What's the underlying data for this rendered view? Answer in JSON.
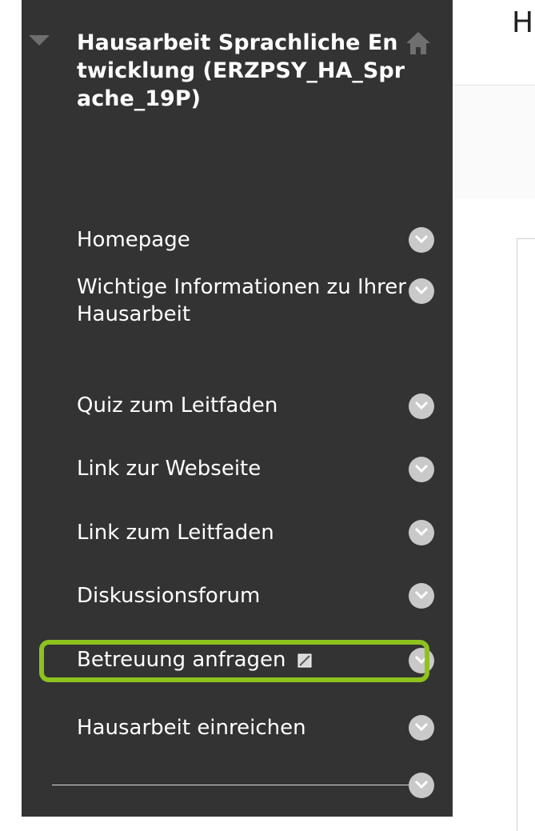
{
  "header": {
    "title_partial": "H"
  },
  "sidebar": {
    "course_title": "Hausarbeit Sprachliche Entwicklung (ERZPSY_HA_Sprache_19P)",
    "items": [
      {
        "label": "Homepage"
      },
      {
        "label": "Wichtige Informationen zu Ihrer Hausarbeit"
      },
      {
        "label": "Quiz zum Leitfaden"
      },
      {
        "label": "Link zur Webseite"
      },
      {
        "label": "Link zum Leitfaden"
      },
      {
        "label": "Diskussionsforum"
      },
      {
        "label": "Betreuung anfragen",
        "hidden_from_students": true,
        "highlighted": true
      },
      {
        "label": "Hausarbeit einreichen"
      }
    ]
  },
  "colors": {
    "sidebar_bg": "#333333",
    "highlight": "#8dc21f",
    "chevron": "#c9c9c9"
  },
  "icons": [
    "collapse-arrow-icon",
    "home-icon",
    "chevron-down-icon",
    "hidden-item-icon"
  ]
}
